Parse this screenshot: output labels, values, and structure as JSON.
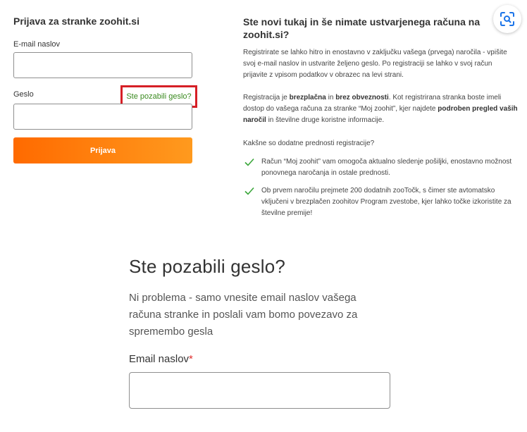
{
  "login": {
    "title": "Prijava za stranke zoohit.si",
    "email_label": "E-mail naslov",
    "email_value": "",
    "password_label": "Geslo",
    "password_value": "",
    "forgot_link": "Ste pozabili geslo?",
    "submit_label": "Prijava"
  },
  "registration": {
    "title": "Ste novi tukaj in še nimate ustvarjenega računa na zoohit.si?",
    "p1": "Registrirate se lahko hitro in enostavno v zaključku vašega (prvega) naročila - vpišite svoj e-mail naslov in ustvarite željeno geslo. Po registraciji se lahko v svoj račun prijavite z vpisom podatkov v obrazec na levi strani.",
    "p2_a": "Registracija je ",
    "p2_b": "brezplačna",
    "p2_c": " in ",
    "p2_d": "brez obveznosti",
    "p2_e": ". Kot registrirana stranka boste imeli dostop do vašega računa za stranke “Moj zoohit”, kjer najdete ",
    "p2_f": "podroben pregled vaših naročil",
    "p2_g": " in številne druge koristne informacije.",
    "p3": "Kakšne so dodatne prednosti registracije?",
    "benefits": [
      {
        "icon": "checkmark-icon",
        "text": "Račun “Moj zoohit” vam omogoča aktualno sledenje pošiljki, enostavno možnost ponovnega naročanja in ostale prednosti."
      },
      {
        "icon": "checkmark-icon",
        "text": "Ob prvem naročilu prejmete 200 dodatnih zooTočk, s čimer ste avtomatsko vključeni v brezplačen zoohitov Program zvestobe, kjer lahko točke izkoristite za številne premije!"
      }
    ]
  },
  "forgot": {
    "title": "Ste pozabili geslo?",
    "description": "Ni problema - samo vnesite email naslov vašega računa stranke in poslali vam bomo povezavo za spremembo gesla",
    "email_label": "Email naslov",
    "required_mark": "*",
    "email_value": ""
  },
  "toolbar": {
    "scan_icon": "lens-scan-icon"
  },
  "colors": {
    "accent_orange": "#ff7a0a",
    "link_green": "#3a8a1f",
    "highlight_red": "#d61f26",
    "check_green": "#3aa63a"
  }
}
